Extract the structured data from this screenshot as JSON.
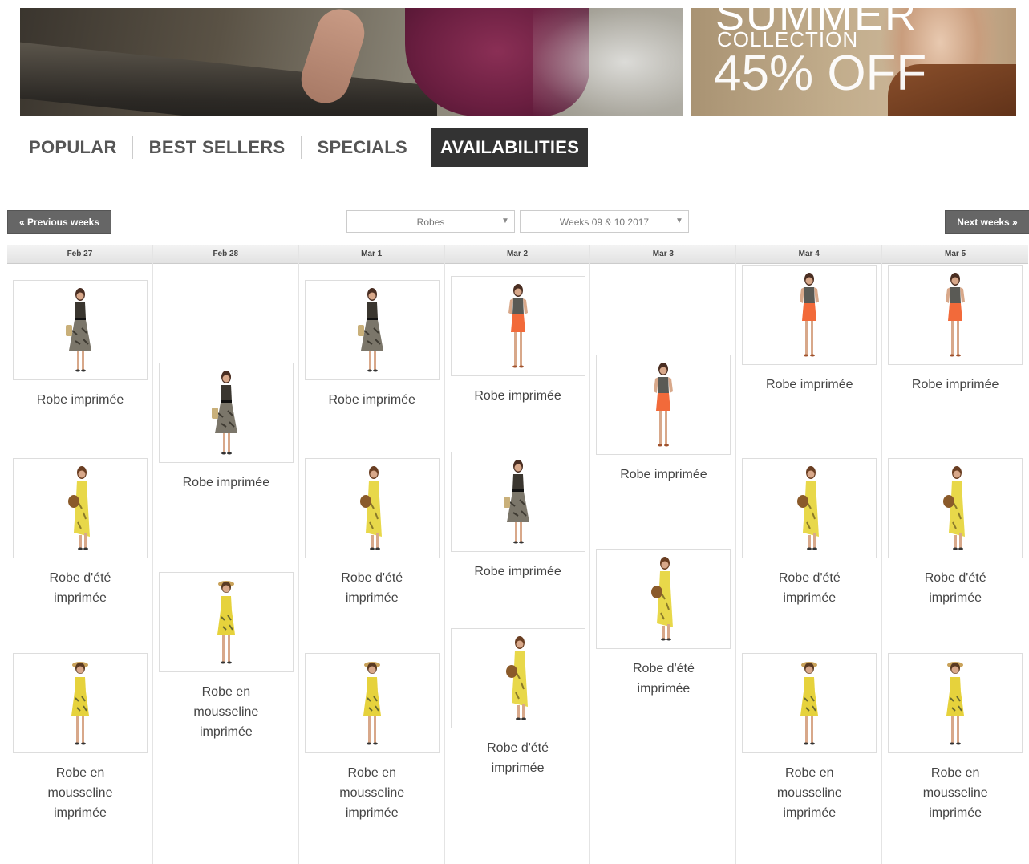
{
  "banner": {
    "right_title": "SUMMER",
    "right_sub": "COLLECTION",
    "right_offer": "45% OFF"
  },
  "tabs": [
    {
      "label": "POPULAR"
    },
    {
      "label": "BEST SELLERS"
    },
    {
      "label": "SPECIALS"
    },
    {
      "label": "AVAILABILITIES",
      "active": true
    }
  ],
  "controls": {
    "prev_label": "« Previous weeks",
    "next_label": "Next weeks »",
    "category_value": "Robes",
    "week_value": "Weeks 09 & 10 2017"
  },
  "days": [
    {
      "label": "Feb 27"
    },
    {
      "label": "Feb 28"
    },
    {
      "label": "Mar 1"
    },
    {
      "label": "Mar 2"
    },
    {
      "label": "Mar 3"
    },
    {
      "label": "Mar 4"
    },
    {
      "label": "Mar 5"
    }
  ],
  "products": {
    "printed_dress": "Robe imprimée",
    "summer_dress": "Robe d'été imprimée",
    "chiffon_dress": "Robe en mousseline imprimée"
  },
  "colors": {
    "leopard": "#6e6a5e",
    "orange": "#f26a3a",
    "yellow": "#e8d84a",
    "tab_active_bg": "#333333"
  }
}
